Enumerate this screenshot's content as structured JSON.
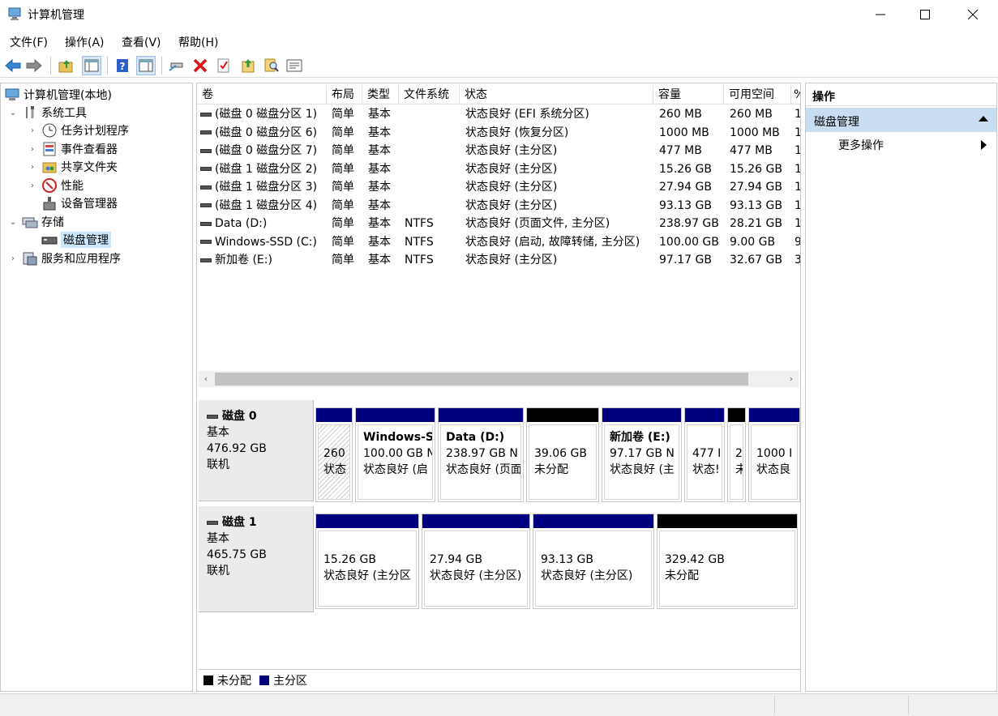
{
  "window": {
    "title": "计算机管理"
  },
  "menu": [
    "文件(F)",
    "操作(A)",
    "查看(V)",
    "帮助(H)"
  ],
  "toolbar": [
    "back-icon",
    "forward-icon",
    "up-folder-icon",
    "show-hide-tree-icon",
    "help-icon",
    "properties-view-icon",
    "connect-icon",
    "delete-icon",
    "checkmark-icon",
    "import-icon",
    "search-icon",
    "properties-icon"
  ],
  "tree": {
    "root": "计算机管理(本地)",
    "system_tools": "系统工具",
    "task_scheduler": "任务计划程序",
    "event_viewer": "事件查看器",
    "shared_folders": "共享文件夹",
    "performance": "性能",
    "device_manager": "设备管理器",
    "storage": "存储",
    "disk_management": "磁盘管理",
    "services_apps": "服务和应用程序"
  },
  "columns": [
    "卷",
    "布局",
    "类型",
    "文件系统",
    "状态",
    "容量",
    "可用空间",
    "%"
  ],
  "volumes": [
    {
      "name": "(磁盘 0 磁盘分区 1)",
      "layout": "简单",
      "type": "基本",
      "fs": "",
      "status": "状态良好 (EFI 系统分区)",
      "capacity": "260 MB",
      "free": "260 MB",
      "pct": "1"
    },
    {
      "name": "(磁盘 0 磁盘分区 6)",
      "layout": "简单",
      "type": "基本",
      "fs": "",
      "status": "状态良好 (恢复分区)",
      "capacity": "1000 MB",
      "free": "1000 MB",
      "pct": "1"
    },
    {
      "name": "(磁盘 0 磁盘分区 7)",
      "layout": "简单",
      "type": "基本",
      "fs": "",
      "status": "状态良好 (主分区)",
      "capacity": "477 MB",
      "free": "477 MB",
      "pct": "1"
    },
    {
      "name": "(磁盘 1 磁盘分区 2)",
      "layout": "简单",
      "type": "基本",
      "fs": "",
      "status": "状态良好 (主分区)",
      "capacity": "15.26 GB",
      "free": "15.26 GB",
      "pct": "1"
    },
    {
      "name": "(磁盘 1 磁盘分区 3)",
      "layout": "简单",
      "type": "基本",
      "fs": "",
      "status": "状态良好 (主分区)",
      "capacity": "27.94 GB",
      "free": "27.94 GB",
      "pct": "1"
    },
    {
      "name": "(磁盘 1 磁盘分区 4)",
      "layout": "简单",
      "type": "基本",
      "fs": "",
      "status": "状态良好 (主分区)",
      "capacity": "93.13 GB",
      "free": "93.13 GB",
      "pct": "1"
    },
    {
      "name": "Data (D:)",
      "layout": "简单",
      "type": "基本",
      "fs": "NTFS",
      "status": "状态良好 (页面文件, 主分区)",
      "capacity": "238.97 GB",
      "free": "28.21 GB",
      "pct": "1"
    },
    {
      "name": "Windows-SSD (C:)",
      "layout": "简单",
      "type": "基本",
      "fs": "NTFS",
      "status": "状态良好 (启动, 故障转储, 主分区)",
      "capacity": "100.00 GB",
      "free": "9.00 GB",
      "pct": "9"
    },
    {
      "name": "新加卷 (E:)",
      "layout": "简单",
      "type": "基本",
      "fs": "NTFS",
      "status": "状态良好 (主分区)",
      "capacity": "97.17 GB",
      "free": "32.67 GB",
      "pct": "3"
    }
  ],
  "disks": [
    {
      "name": "磁盘 0",
      "type": "基本",
      "size": "476.92 GB",
      "state": "联机",
      "partitions": [
        {
          "title": "",
          "line1": "260",
          "line2": "状态",
          "kind": "primary",
          "hatched": true
        },
        {
          "title": "Windows-S",
          "line1": "100.00 GB N",
          "line2": "状态良好 (启",
          "kind": "primary"
        },
        {
          "title": "Data  (D:)",
          "line1": "238.97 GB N",
          "line2": "状态良好 (页面",
          "kind": "primary"
        },
        {
          "title": "",
          "line1": "39.06 GB",
          "line2": "未分配",
          "kind": "unallocated"
        },
        {
          "title": "新加卷  (E:)",
          "line1": "97.17 GB N",
          "line2": "状态良好 (主",
          "kind": "primary"
        },
        {
          "title": "",
          "line1": "477 I",
          "line2": "状态!",
          "kind": "primary"
        },
        {
          "title": "",
          "line1": "2",
          "line2": "未",
          "kind": "unallocated"
        },
        {
          "title": "",
          "line1": "1000 I",
          "line2": "状态良",
          "kind": "primary"
        }
      ]
    },
    {
      "name": "磁盘 1",
      "type": "基本",
      "size": "465.75 GB",
      "state": "联机",
      "partitions": [
        {
          "title": "",
          "line1": "15.26 GB",
          "line2": "状态良好 (主分区",
          "kind": "primary"
        },
        {
          "title": "",
          "line1": "27.94 GB",
          "line2": "状态良好 (主分区)",
          "kind": "primary"
        },
        {
          "title": "",
          "line1": "93.13 GB",
          "line2": "状态良好 (主分区)",
          "kind": "primary"
        },
        {
          "title": "",
          "line1": "329.42 GB",
          "line2": "未分配",
          "kind": "unallocated"
        }
      ]
    }
  ],
  "legend": {
    "unallocated": "未分配",
    "primary": "主分区"
  },
  "colors": {
    "primary": "#00007f",
    "unallocated": "#000000",
    "selected_group": "#c9ddf0"
  },
  "actions": {
    "header": "操作",
    "group": "磁盘管理",
    "more": "更多操作"
  }
}
